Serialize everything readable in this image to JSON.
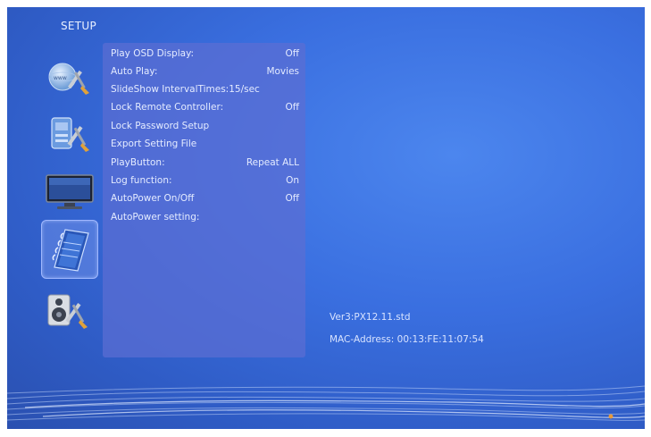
{
  "header": {
    "title": "SETUP"
  },
  "sidebar": {
    "items": [
      {
        "icon": "globe-tools-icon",
        "selected": false
      },
      {
        "icon": "device-tools-icon",
        "selected": false
      },
      {
        "icon": "tv-monitor-icon",
        "selected": false
      },
      {
        "icon": "notebook-settings-icon",
        "selected": true
      },
      {
        "icon": "speaker-tools-icon",
        "selected": false
      }
    ]
  },
  "menu": {
    "items": [
      {
        "label": "Play OSD Display:",
        "value": "Off"
      },
      {
        "label": "Auto Play:",
        "value": "Movies"
      },
      {
        "label": "SlideShow IntervalTimes:15/sec",
        "value": ""
      },
      {
        "label": "Lock Remote Controller:",
        "value": "Off"
      },
      {
        "label": "Lock Password Setup",
        "value": ""
      },
      {
        "label": "Export Setting File",
        "value": ""
      },
      {
        "label": "PlayButton:",
        "value": "Repeat ALL"
      },
      {
        "label": "Log function:",
        "value": "On"
      },
      {
        "label": "AutoPower On/Off",
        "value": "Off"
      },
      {
        "label": "AutoPower setting:",
        "value": ""
      }
    ]
  },
  "info": {
    "version": "Ver3:PX12.11.std",
    "mac": "MAC-Address: 00:13:FE:11:07:54"
  }
}
